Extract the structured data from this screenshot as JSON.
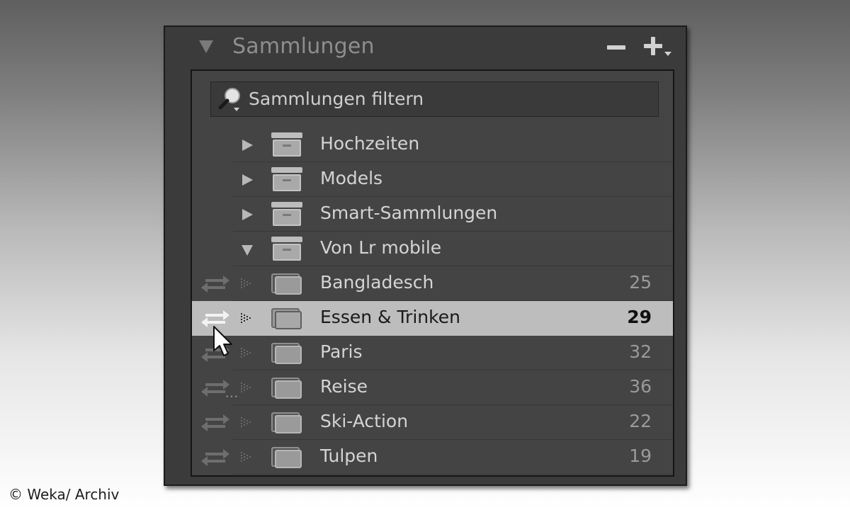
{
  "panel": {
    "title": "Sammlungen",
    "collapse_icon": "disclosure-triangle-down-icon",
    "remove_icon": "minus-icon",
    "add_icon": "plus-with-dropdown-icon"
  },
  "search": {
    "text": "Sammlungen filtern",
    "icon": "search-magnifier-icon"
  },
  "sets": [
    {
      "label": "Hochzeiten",
      "expanded": false,
      "icon": "collection-set-icon"
    },
    {
      "label": "Models",
      "expanded": false,
      "icon": "collection-set-icon"
    },
    {
      "label": "Smart-Sammlungen",
      "expanded": false,
      "icon": "collection-set-icon"
    },
    {
      "label": "Von Lr mobile",
      "expanded": true,
      "icon": "collection-set-icon"
    }
  ],
  "collections": [
    {
      "label": "Bangladesch",
      "count": "25",
      "selected": false,
      "icon": "collection-icon",
      "sync_icon": "sync-arrows-icon"
    },
    {
      "label": "Essen & Trinken",
      "count": "29",
      "selected": true,
      "icon": "collection-icon",
      "sync_icon": "sync-arrows-icon"
    },
    {
      "label": "Paris",
      "count": "32",
      "selected": false,
      "icon": "collection-icon",
      "sync_icon": "sync-arrows-icon"
    },
    {
      "label": "Reise",
      "count": "36",
      "selected": false,
      "icon": "collection-icon",
      "sync_icon": "sync-arrows-pending-icon"
    },
    {
      "label": "Ski-Action",
      "count": "22",
      "selected": false,
      "icon": "collection-icon",
      "sync_icon": "sync-arrows-icon"
    },
    {
      "label": "Tulpen",
      "count": "19",
      "selected": false,
      "icon": "collection-icon",
      "sync_icon": "sync-arrows-icon"
    }
  ],
  "credit": "© Weka/ Archiv",
  "colors": {
    "panel_bg": "#3b3b3b",
    "list_bg": "#444444",
    "selected_row": "#bdbdbd",
    "text": "#d4d4d4",
    "header_text": "#8e8e8e"
  }
}
